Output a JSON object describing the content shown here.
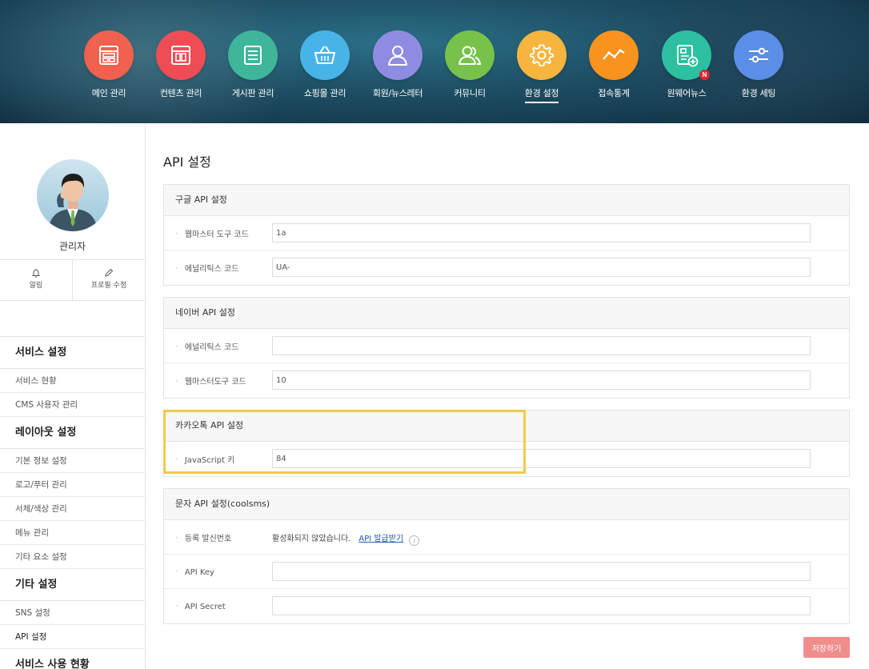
{
  "nav": [
    {
      "label": "메인 관리",
      "icon": "layout-icon",
      "color": "#f0614f"
    },
    {
      "label": "컨텐츠 관리",
      "icon": "content-icon",
      "color": "#ee4d55"
    },
    {
      "label": "게시판 관리",
      "icon": "list-icon",
      "color": "#3fb59a"
    },
    {
      "label": "쇼핑몰 관리",
      "icon": "basket-icon",
      "color": "#48b3e6"
    },
    {
      "label": "회원/뉴스레터",
      "icon": "user-icon",
      "color": "#8e8ce0"
    },
    {
      "label": "커뮤니티",
      "icon": "users-icon",
      "color": "#76c24b"
    },
    {
      "label": "환경 설정",
      "icon": "gear-icon",
      "color": "#f6b53f",
      "active": true
    },
    {
      "label": "접속통계",
      "icon": "chart-icon",
      "color": "#f7931e"
    },
    {
      "label": "원웨어뉴스",
      "icon": "news-icon",
      "color": "#2cc0a1",
      "badge": "N"
    },
    {
      "label": "환경 세팅",
      "icon": "sliders-icon",
      "color": "#5b8ee6"
    }
  ],
  "profile": {
    "name": "관리자",
    "actions": [
      {
        "label": "알림",
        "icon": "bell-icon"
      },
      {
        "label": "프로필 수정",
        "icon": "pencil-icon"
      }
    ]
  },
  "sidebar": {
    "sections": [
      {
        "title": "서비스 설정",
        "items": [
          "서비스 현황",
          "CMS 사용자 관리"
        ]
      },
      {
        "title": "레이아웃 설정",
        "items": [
          "기본 정보 설정",
          "로고/푸터 관리",
          "서체/색상 관리",
          "메뉴 관리",
          "기타 요소 설정"
        ]
      },
      {
        "title": "기타 설정",
        "items": [
          "SNS 설정",
          "API 설정"
        ]
      },
      {
        "title": "서비스 사용 현황",
        "items": []
      }
    ],
    "active_item": "API 설정"
  },
  "page": {
    "title": "API 설정"
  },
  "panels": {
    "google": {
      "title": "구글 API 설정",
      "rows": [
        {
          "label": "웹마스터 도구 코드",
          "value": "1a"
        },
        {
          "label": "에널리틱스 코드",
          "value": "UA-"
        }
      ]
    },
    "naver": {
      "title": "네이버 API 설정",
      "rows": [
        {
          "label": "에널리틱스 코드",
          "value": ""
        },
        {
          "label": "웹마스터도구 코드",
          "value": "10"
        }
      ]
    },
    "kakao": {
      "title": "카카오톡 API 설정",
      "rows": [
        {
          "label": "JavaScript 키",
          "value": "84"
        }
      ]
    },
    "sms": {
      "title": "문자 API 설정(coolsms)",
      "sender_label": "등록 발신번호",
      "sender_status": "활성화되지 않았습니다.",
      "sender_link": "API 발급받기",
      "info_glyph": "i",
      "rows": [
        {
          "label": "API Key",
          "value": ""
        },
        {
          "label": "API Secret",
          "value": ""
        }
      ]
    }
  },
  "actions": {
    "save_label": "저장하기"
  },
  "colors": {
    "highlight": "#f3c94a",
    "save_button": "#f08e8e",
    "link": "#1f5aa6"
  }
}
